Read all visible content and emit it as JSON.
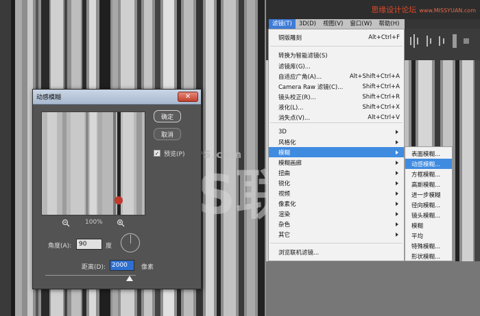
{
  "watermark": {
    "top_text": "思缘设计论坛",
    "top_site": "www.MISSYUAN.com",
    "sub_text": "68PS.com",
    "logo_text": "PS联盟"
  },
  "dialog": {
    "title": "动感模糊",
    "close_label": "✕",
    "ok_label": "确定",
    "cancel_label": "取消",
    "preview_label": "预览(P)",
    "preview_checked": true,
    "zoom_level": "100%",
    "angle_label": "角度(A):",
    "angle_value": "90",
    "angle_unit": "度",
    "distance_label": "距离(D):",
    "distance_value": "2000",
    "distance_unit": "像素",
    "distance_fraction": 0.93
  },
  "menubar": {
    "items": [
      "滤镜(T)",
      "3D(D)",
      "视图(V)",
      "窗口(W)",
      "帮助(H)"
    ],
    "active_index": 0
  },
  "filter_menu": {
    "items": [
      {
        "label": "铜版雕刻",
        "shortcut": "Alt+Ctrl+F"
      },
      {
        "label": "转换为智能滤镜(S)",
        "shortcut": ""
      },
      {
        "label": "滤镜库(G)...",
        "shortcut": ""
      },
      {
        "label": "自适应广角(A)...",
        "shortcut": "Alt+Shift+Ctrl+A"
      },
      {
        "label": "Camera Raw 滤镜(C)...",
        "shortcut": "Shift+Ctrl+A"
      },
      {
        "label": "镜头校正(R)...",
        "shortcut": "Shift+Ctrl+R"
      },
      {
        "label": "液化(L)...",
        "shortcut": "Shift+Ctrl+X"
      },
      {
        "label": "消失点(V)...",
        "shortcut": "Alt+Ctrl+V"
      },
      {
        "label": "3D",
        "shortcut": ""
      },
      {
        "label": "风格化",
        "shortcut": ""
      },
      {
        "label": "模糊",
        "shortcut": ""
      },
      {
        "label": "模糊画廊",
        "shortcut": ""
      },
      {
        "label": "扭曲",
        "shortcut": ""
      },
      {
        "label": "锐化",
        "shortcut": ""
      },
      {
        "label": "视频",
        "shortcut": ""
      },
      {
        "label": "像素化",
        "shortcut": ""
      },
      {
        "label": "渲染",
        "shortcut": ""
      },
      {
        "label": "杂色",
        "shortcut": ""
      },
      {
        "label": "其它",
        "shortcut": ""
      },
      {
        "label": "浏览联机滤镜...",
        "shortcut": ""
      }
    ],
    "highlighted": "模糊"
  },
  "blur_submenu": {
    "items": [
      "表面模糊...",
      "动感模糊...",
      "方框模糊...",
      "高斯模糊...",
      "进一步模糊",
      "径向模糊...",
      "镜头模糊...",
      "模糊",
      "平均",
      "特殊模糊...",
      "形状模糊..."
    ],
    "highlighted": "动感模糊..."
  }
}
